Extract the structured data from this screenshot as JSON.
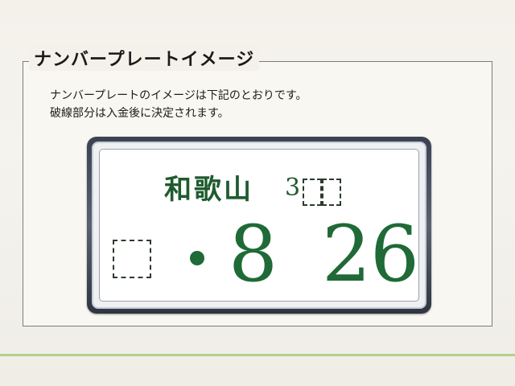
{
  "section": {
    "legend": "ナンバープレートイメージ",
    "intro_line1": "ナンバープレートのイメージは下記のとおりです。",
    "intro_line2": "破線部分は入金後に決定されます。"
  },
  "plate": {
    "region": "和歌山",
    "class_prefix": "3",
    "number_dot": "・",
    "digit1": "8",
    "digit2": "2",
    "digit3": "6",
    "text_color": "#1f6a36",
    "frame_color": "#3b4252"
  }
}
